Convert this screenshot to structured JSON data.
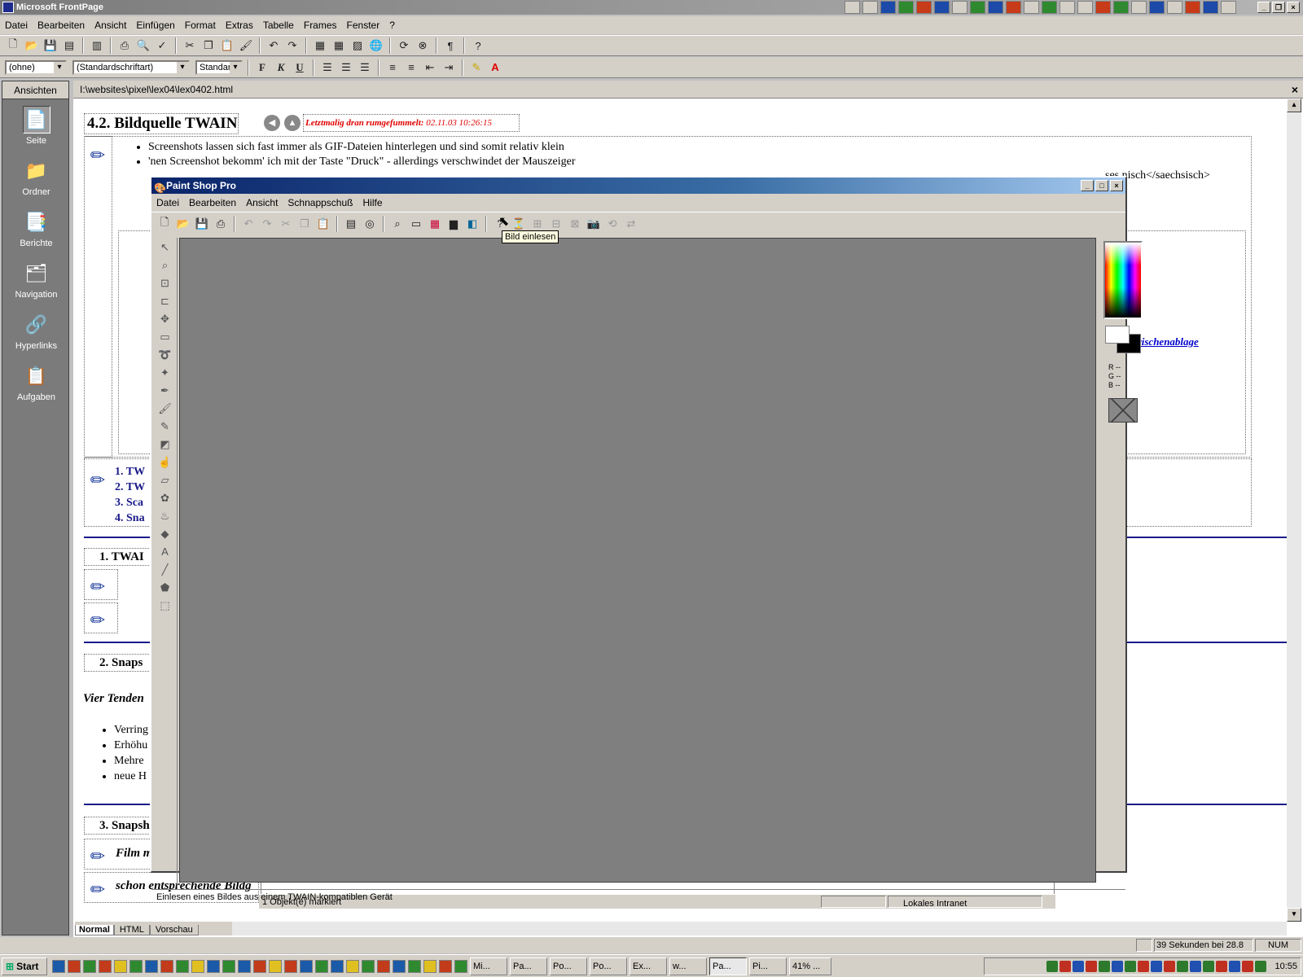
{
  "frontpage": {
    "title": "Microsoft FrontPage",
    "menu": [
      "Datei",
      "Bearbeiten",
      "Ansicht",
      "Einfügen",
      "Format",
      "Extras",
      "Tabelle",
      "Frames",
      "Fenster",
      "?"
    ],
    "style_combo": "(ohne)",
    "font_combo": "(Standardschriftart)",
    "size_combo": "Standard",
    "format_buttons": [
      "F",
      "K",
      "U"
    ],
    "views_header": "Ansichten",
    "views": [
      {
        "label": "Seite",
        "icon": "page-icon"
      },
      {
        "label": "Ordner",
        "icon": "folder-icon"
      },
      {
        "label": "Berichte",
        "icon": "reports-icon"
      },
      {
        "label": "Navigation",
        "icon": "navigation-icon"
      },
      {
        "label": "Hyperlinks",
        "icon": "hyperlinks-icon"
      },
      {
        "label": "Aufgaben",
        "icon": "tasks-icon"
      }
    ],
    "file_path": "I:\\websites\\pixel\\lex04\\lex0402.html",
    "close_doc": "×",
    "view_tabs": [
      "Normal",
      "HTML",
      "Vorschau"
    ],
    "statusbar": {
      "timer": "39 Sekunden bei 28.8",
      "num": "NUM"
    }
  },
  "document": {
    "heading": "4.2. Bildquelle TWAIN",
    "modified_label": "Letztmalig dran rumgefummelt:",
    "modified_date": "02.11.03 10:26:15",
    "bullets": [
      "Screenshots lassen sich fast immer als GIF-Dateien hinterlegen und sind somit relativ klein",
      "'nen Screenshot bekomm' ich mit der Taste \"Druck\" - allerdings verschwindet der Mauszeiger"
    ],
    "bullet3_tail": "ses nisch</saechsisch>",
    "link_tail": "e die Zwischenablage",
    "toc": [
      "1. TW",
      "2. TW",
      "3. Sca",
      "4. Sna"
    ],
    "sec1": "1. TWAI",
    "sec2": "2. Snaps",
    "italic_line": "Vier Tenden",
    "sec2_bullets": [
      "Verring",
      "Erhöhu",
      "Mehre",
      "neue H"
    ],
    "sec3": "3. Snapsh",
    "italic2": "Film mit Pausentaste anh",
    "italic3": "schon entsprechende Bildg"
  },
  "background_window": {
    "status": "1 Objekt(e) markiert",
    "zone": "Lokales Intranet"
  },
  "psp": {
    "title": "Paint Shop Pro",
    "menu": [
      "Datei",
      "Bearbeiten",
      "Ansicht",
      "Schnappschuß",
      "Hilfe"
    ],
    "tooltip": "Bild einlesen",
    "status": "Einlesen eines Bildes aus einem TWAIN-kompatiblen Gerät",
    "rgb": [
      "R --",
      "G --",
      "B --"
    ]
  },
  "taskbar": {
    "start": "Start",
    "tasks": [
      "Mi...",
      "Pa...",
      "Po...",
      "Po...",
      "Ex...",
      "w...",
      "Pa...",
      "Pi...",
      "41% ..."
    ],
    "clock": "10:55"
  }
}
